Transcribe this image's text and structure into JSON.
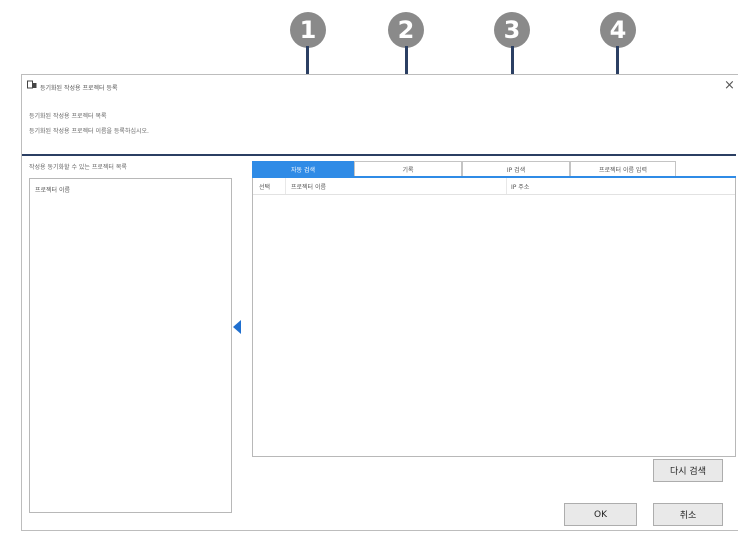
{
  "callouts": [
    "1",
    "2",
    "3",
    "4"
  ],
  "window": {
    "title": "등기화된 작성용 프로젝터 등록",
    "close_symbol": "×",
    "description_line1": "등기화된 작성용 프로젝터 목록",
    "description_line2": "등기화된 작성용 프로젝터 이름을 등록하십시오."
  },
  "left": {
    "label": "작성용 동기화할 수 있는 프로젝터 목록",
    "column_header": "프로젝터 이름"
  },
  "tabs": [
    {
      "label": "자동 검색",
      "active": true
    },
    {
      "label": "기록",
      "active": false
    },
    {
      "label": "IP 검색",
      "active": false
    },
    {
      "label": "프로젝터 이름 입력",
      "active": false
    }
  ],
  "table": {
    "columns": [
      "선택",
      "프로젝터 이름",
      "IP 주소"
    ]
  },
  "buttons": {
    "rescan": "다시 검색",
    "ok": "OK",
    "cancel": "취소"
  },
  "colors": {
    "accent": "#2f8be6",
    "callout": "#8a8a8a",
    "callout_line": "#2b3f63"
  }
}
